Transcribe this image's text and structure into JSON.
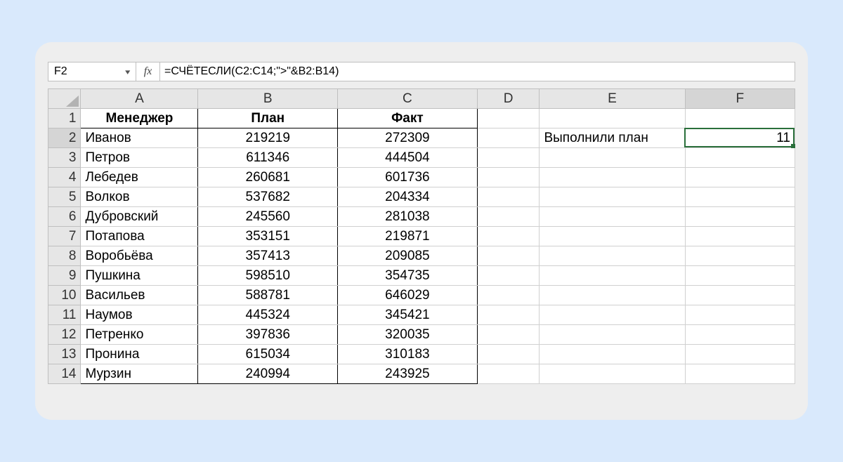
{
  "formula_bar": {
    "cell_ref": "F2",
    "fx_label": "fx",
    "formula": "=СЧЁТЕСЛИ(C2:C14;\">\"&B2:B14)"
  },
  "columns": [
    "A",
    "B",
    "C",
    "D",
    "E",
    "F"
  ],
  "selected_column": "F",
  "selected_row": 2,
  "headers": {
    "A": "Менеджер",
    "B": "План",
    "C": "Факт"
  },
  "rows": [
    {
      "n": 2,
      "A": "Иванов",
      "B": "219219",
      "C": "272309",
      "E": "Выполнили план",
      "F": "11"
    },
    {
      "n": 3,
      "A": "Петров",
      "B": "611346",
      "C": "444504"
    },
    {
      "n": 4,
      "A": "Лебедев",
      "B": "260681",
      "C": "601736"
    },
    {
      "n": 5,
      "A": "Волков",
      "B": "537682",
      "C": "204334"
    },
    {
      "n": 6,
      "A": "Дубровский",
      "B": "245560",
      "C": "281038"
    },
    {
      "n": 7,
      "A": "Потапова",
      "B": "353151",
      "C": "219871"
    },
    {
      "n": 8,
      "A": "Воробьёва",
      "B": "357413",
      "C": "209085"
    },
    {
      "n": 9,
      "A": "Пушкина",
      "B": "598510",
      "C": "354735"
    },
    {
      "n": 10,
      "A": "Васильев",
      "B": "588781",
      "C": "646029"
    },
    {
      "n": 11,
      "A": "Наумов",
      "B": "445324",
      "C": "345421"
    },
    {
      "n": 12,
      "A": "Петренко",
      "B": "397836",
      "C": "320035"
    },
    {
      "n": 13,
      "A": "Пронина",
      "B": "615034",
      "C": "310183"
    },
    {
      "n": 14,
      "A": "Мурзин",
      "B": "240994",
      "C": "243925"
    }
  ],
  "chart_data": {
    "type": "table",
    "title": "",
    "columns": [
      "Менеджер",
      "План",
      "Факт"
    ],
    "data": [
      [
        "Иванов",
        219219,
        272309
      ],
      [
        "Петров",
        611346,
        444504
      ],
      [
        "Лебедев",
        260681,
        601736
      ],
      [
        "Волков",
        537682,
        204334
      ],
      [
        "Дубровский",
        245560,
        281038
      ],
      [
        "Потапова",
        353151,
        219871
      ],
      [
        "Воробьёва",
        357413,
        209085
      ],
      [
        "Пушкина",
        598510,
        354735
      ],
      [
        "Васильев",
        588781,
        646029
      ],
      [
        "Наумов",
        445324,
        345421
      ],
      [
        "Петренко",
        397836,
        320035
      ],
      [
        "Пронина",
        615034,
        310183
      ],
      [
        "Мурзин",
        240994,
        243925
      ]
    ],
    "summary": {
      "label": "Выполнили план",
      "value": 11
    }
  }
}
